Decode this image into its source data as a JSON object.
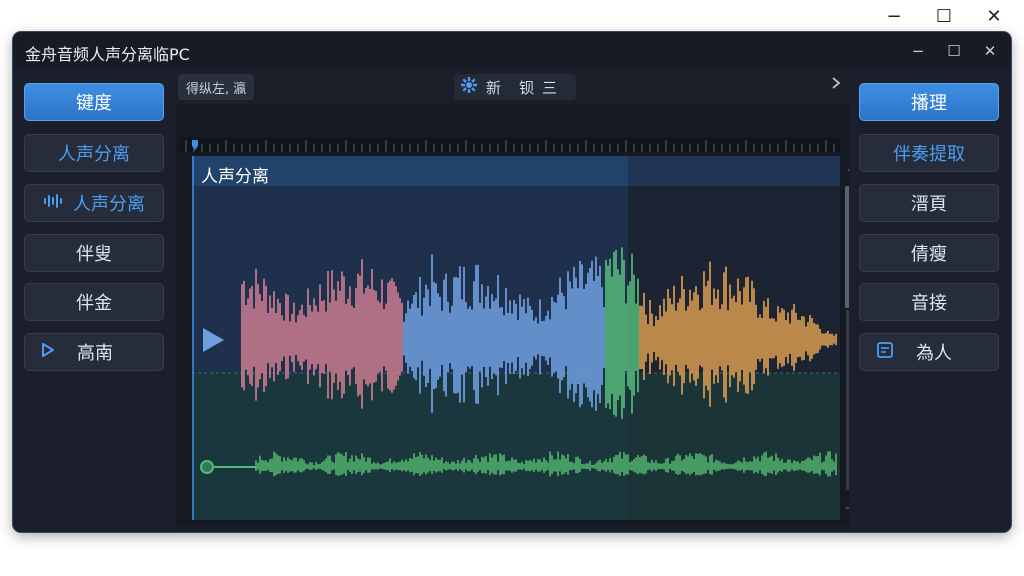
{
  "outer_window": {
    "controls": [
      "−",
      "☐",
      "✕"
    ]
  },
  "app": {
    "title": "金舟音频人声分离临PC",
    "window_controls": [
      "−",
      "☐",
      "✕"
    ]
  },
  "left_sidebar": {
    "items": [
      {
        "label": "键度",
        "icon": "",
        "style": "primary"
      },
      {
        "label": "人声分离",
        "icon": "",
        "style": "blue"
      },
      {
        "label": "人声分离",
        "icon": "waveform-icon",
        "style": "blue"
      },
      {
        "label": "伴叟",
        "icon": "",
        "style": "normal"
      },
      {
        "label": "伴金",
        "icon": "",
        "style": "normal"
      },
      {
        "label": "高南",
        "icon": "play-icon",
        "style": "normal"
      }
    ]
  },
  "right_sidebar": {
    "items": [
      {
        "label": "播理",
        "icon": "",
        "style": "primary"
      },
      {
        "label": "伴奏提取",
        "icon": "",
        "style": "blue"
      },
      {
        "label": "溍頁",
        "icon": "",
        "style": "normal"
      },
      {
        "label": "倩瘦",
        "icon": "",
        "style": "normal"
      },
      {
        "label": "音接",
        "icon": "",
        "style": "normal"
      },
      {
        "label": "為人",
        "icon": "file-icon",
        "style": "normal"
      }
    ]
  },
  "editor": {
    "toolbar_left_label": "得纵左, 瀛",
    "toolbar_center_icon": "gear-icon",
    "toolbar_center_items": [
      "新",
      "钡",
      "三"
    ],
    "next_icon": "chevron-right-icon",
    "track_label": "人声分离",
    "colors": {
      "pink": "#c97a8f",
      "blue": "#6f9fe0",
      "green": "#55b97a",
      "orange": "#d79a50",
      "accompaniment": "#4fae6a",
      "selection": "#1e3a5c",
      "accent": "#3d8ee6"
    }
  }
}
